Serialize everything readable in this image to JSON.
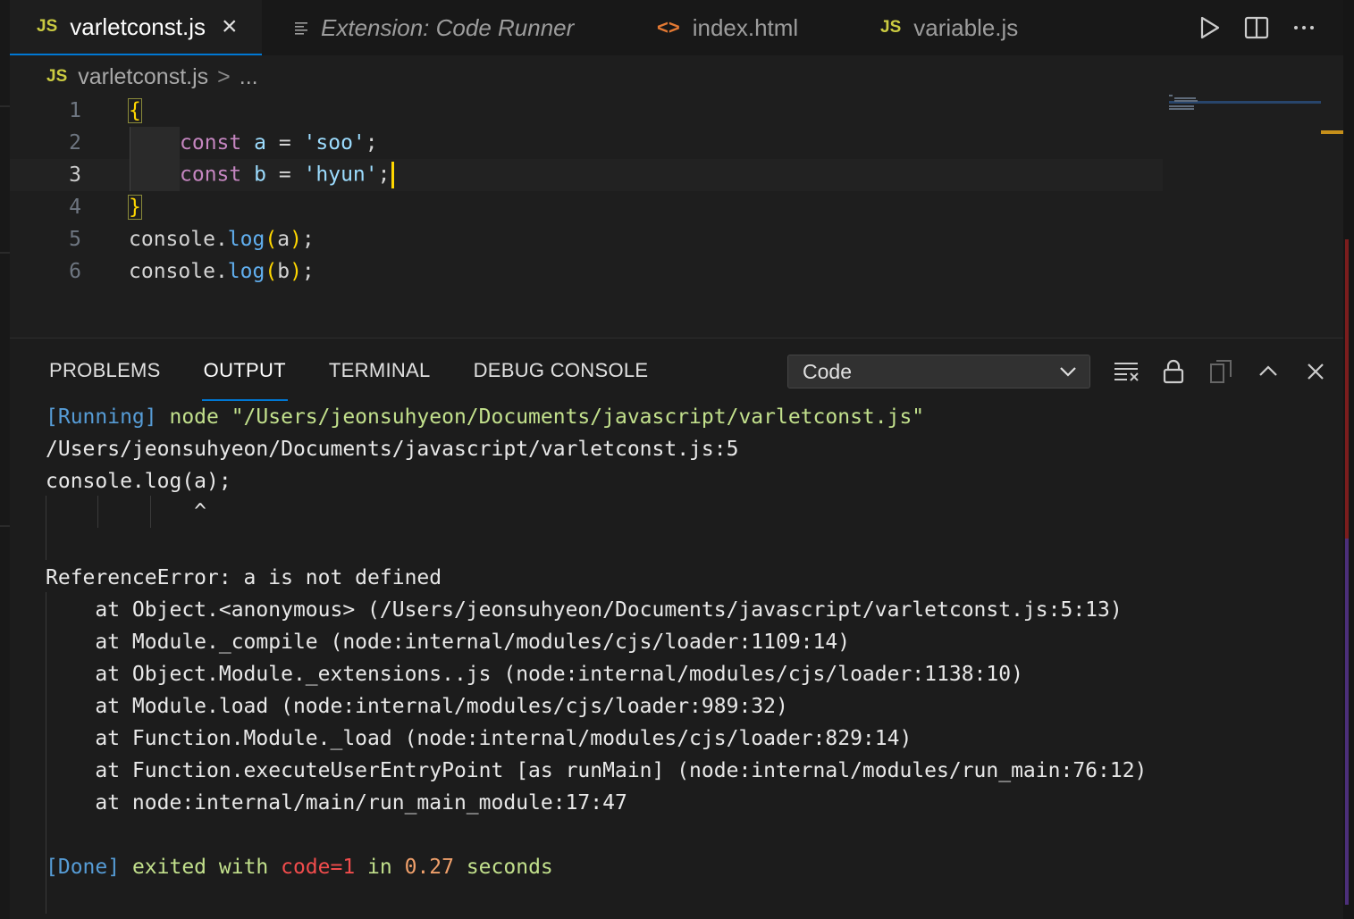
{
  "tabs": [
    {
      "badge": "JS",
      "label": "varletconst.js",
      "active": true,
      "close": "×"
    },
    {
      "label": "Extension: Code Runner",
      "italic": true
    },
    {
      "badge": "<>",
      "label": "index.html"
    },
    {
      "badge": "JS",
      "label": "variable.js"
    }
  ],
  "breadcrumb": {
    "badge": "JS",
    "file": "varletconst.js",
    "separator": ">",
    "rest": "..."
  },
  "editor": {
    "line_numbers": [
      "1",
      "2",
      "3",
      "4",
      "5",
      "6"
    ],
    "current_line": 3
  },
  "panel": {
    "tabs": [
      "PROBLEMS",
      "OUTPUT",
      "TERMINAL",
      "DEBUG CONSOLE"
    ],
    "active_tab": "OUTPUT",
    "channel_select": "Code"
  },
  "output": {
    "running_tag": "[Running]",
    "running_cmd": " node \"/Users/jeonsuhyeon/Documents/javascript/varletconst.js\"",
    "lines": [
      "/Users/jeonsuhyeon/Documents/javascript/varletconst.js:5",
      "console.log(a);",
      "            ^",
      "",
      "ReferenceError: a is not defined",
      "    at Object.<anonymous> (/Users/jeonsuhyeon/Documents/javascript/varletconst.js:5:13)",
      "    at Module._compile (node:internal/modules/cjs/loader:1109:14)",
      "    at Object.Module._extensions..js (node:internal/modules/cjs/loader:1138:10)",
      "    at Module.load (node:internal/modules/cjs/loader:989:32)",
      "    at Function.Module._load (node:internal/modules/cjs/loader:829:14)",
      "    at Function.executeUserEntryPoint [as runMain] (node:internal/modules/run_main:76:12)",
      "    at node:internal/main/run_main_module:17:47"
    ],
    "done_tag": "[Done]",
    "done_text1": " exited with ",
    "done_code": "code=1",
    "done_text2": " in ",
    "done_time": "0.27",
    "done_text3": " seconds"
  },
  "colors": {
    "accent": "#0078d4",
    "js_badge": "#cbcb41",
    "bracket": "#ffd700",
    "error_code": "#f14c4c"
  }
}
